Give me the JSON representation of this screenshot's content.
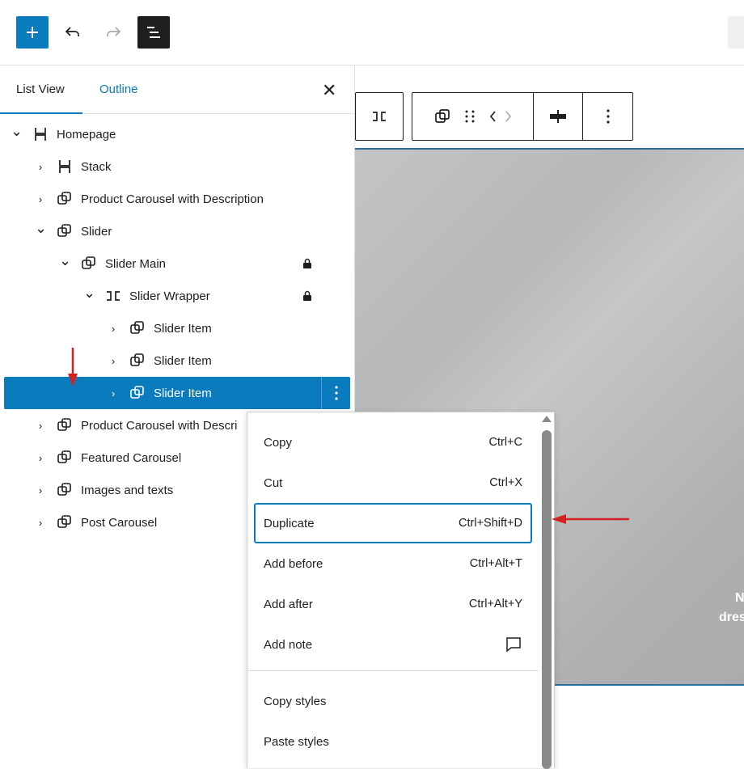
{
  "sidebar": {
    "tabs": [
      "List View",
      "Outline"
    ],
    "items": [
      {
        "label": "Homepage",
        "level": 0,
        "icon": "stack-icon",
        "open": true
      },
      {
        "label": "Stack",
        "level": 1,
        "icon": "stack-icon"
      },
      {
        "label": "Product Carousel with Description",
        "level": 1,
        "icon": "group-icon"
      },
      {
        "label": "Slider",
        "level": 1,
        "icon": "group-icon",
        "open": true
      },
      {
        "label": "Slider Main",
        "level": 2,
        "icon": "group-icon",
        "open": true,
        "locked": true
      },
      {
        "label": "Slider Wrapper",
        "level": 3,
        "icon": "row-icon",
        "open": true,
        "locked": true
      },
      {
        "label": "Slider Item",
        "level": 4,
        "icon": "group-icon"
      },
      {
        "label": "Slider Item",
        "level": 4,
        "icon": "group-icon"
      },
      {
        "label": "Slider Item",
        "level": 4,
        "icon": "group-icon",
        "selected": true
      },
      {
        "label": "Product Carousel with Descri",
        "level": 1,
        "icon": "group-icon"
      },
      {
        "label": "Featured Carousel",
        "level": 1,
        "icon": "group-icon"
      },
      {
        "label": "Images and texts",
        "level": 1,
        "icon": "group-icon"
      },
      {
        "label": "Post Carousel",
        "level": 1,
        "icon": "group-icon"
      }
    ]
  },
  "menu": {
    "items": [
      {
        "label": "Copy",
        "shortcut": "Ctrl+C"
      },
      {
        "label": "Cut",
        "shortcut": "Ctrl+X"
      },
      {
        "label": "Duplicate",
        "shortcut": "Ctrl+Shift+D"
      },
      {
        "label": "Add before",
        "shortcut": "Ctrl+Alt+T"
      },
      {
        "label": "Add after",
        "shortcut": "Ctrl+Alt+Y"
      },
      {
        "label": "Add note",
        "shortcut": ""
      }
    ],
    "items2": [
      {
        "label": "Copy styles"
      },
      {
        "label": "Paste styles"
      }
    ]
  },
  "canvas": {
    "text1": "N",
    "text2": "dres"
  },
  "colors": {
    "accent": "#0a7bbd",
    "arrow": "#d42020"
  }
}
